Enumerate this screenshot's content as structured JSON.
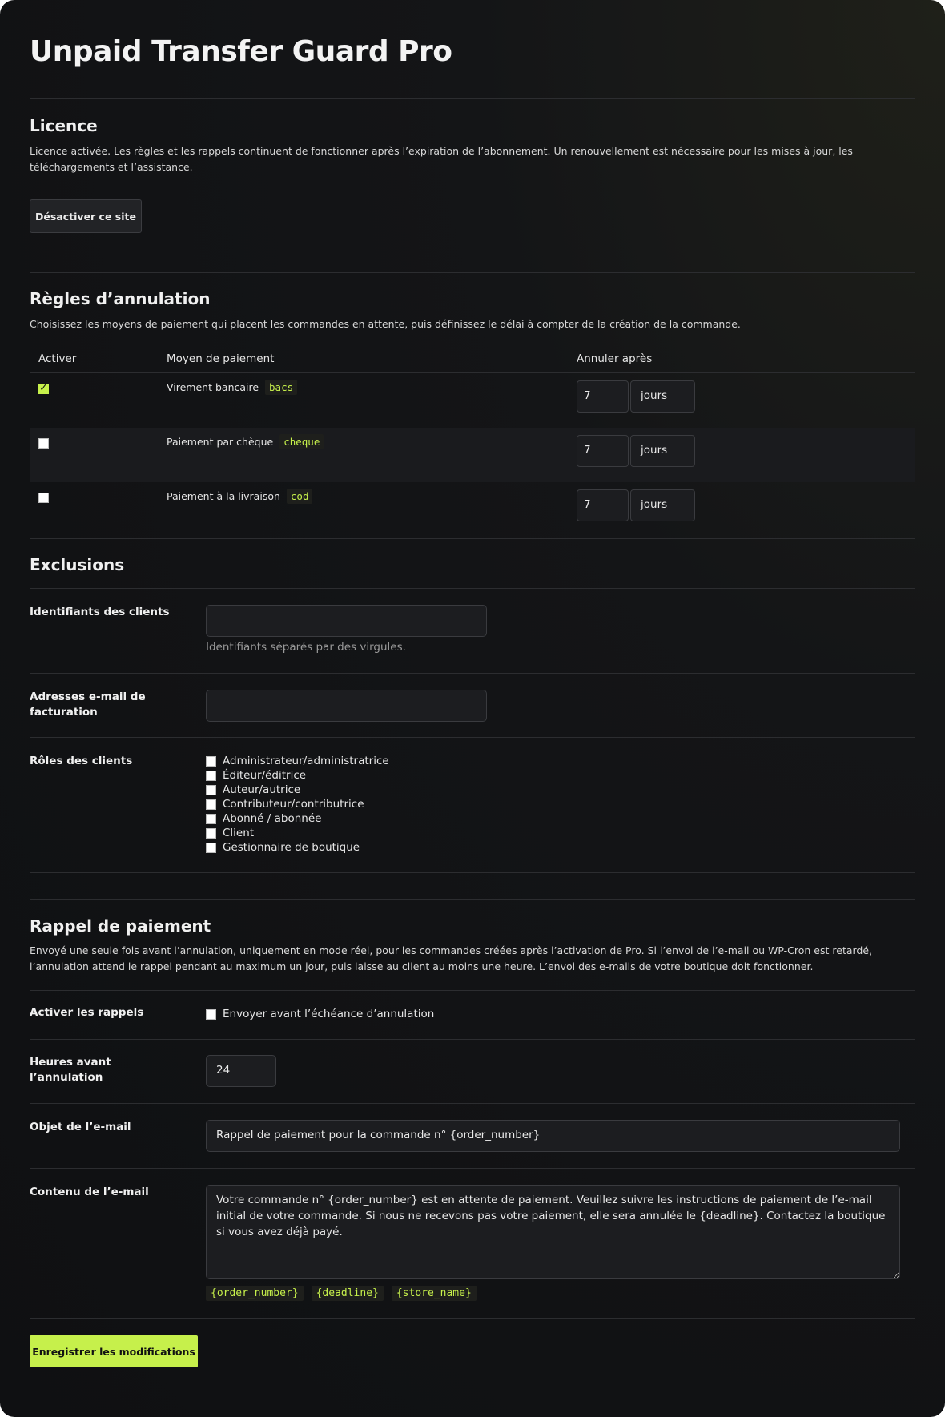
{
  "page": {
    "title": "Unpaid Transfer Guard Pro"
  },
  "license": {
    "heading": "Licence",
    "description": "Licence activée. Les règles et les rappels continuent de fonctionner après l’expiration de l’abonnement. Un renouvellement est nécessaire pour les mises à jour, les téléchargements et l’assistance.",
    "deactivate_label": "Désactiver ce site"
  },
  "rules": {
    "heading": "Règles d’annulation",
    "description": "Choisissez les moyens de paiement qui placent les commandes en attente, puis définissez le délai à compter de la création de la commande.",
    "columns": {
      "enable": "Activer",
      "method": "Moyen de paiement",
      "cancel_after": "Annuler après"
    },
    "rows": [
      {
        "enabled": true,
        "label": "Virement bancaire",
        "code": "bacs",
        "value": "7",
        "unit": "jours"
      },
      {
        "enabled": false,
        "label": "Paiement par chèque",
        "code": "cheque",
        "value": "7",
        "unit": "jours"
      },
      {
        "enabled": false,
        "label": "Paiement à la livraison",
        "code": "cod",
        "value": "7",
        "unit": "jours"
      }
    ]
  },
  "exclusions": {
    "heading": "Exclusions",
    "customer_ids_label": "Identifiants des clients",
    "customer_ids_value": "",
    "customer_ids_hint": "Identifiants séparés par des virgules.",
    "billing_emails_label": "Adresses e-mail de facturation",
    "billing_emails_value": "",
    "roles_label": "Rôles des clients",
    "roles": [
      "Administrateur/administratrice",
      "Éditeur/éditrice",
      "Auteur/autrice",
      "Contributeur/contributrice",
      "Abonné / abonnée",
      "Client",
      "Gestionnaire de boutique"
    ]
  },
  "reminder": {
    "heading": "Rappel de paiement",
    "description": "Envoyé une seule fois avant l’annulation, uniquement en mode réel, pour les commandes créées après l’activation de Pro. Si l’envoi de l’e-mail ou WP-Cron est retardé, l’annulation attend le rappel pendant au maximum un jour, puis laisse au client au moins une heure. L’envoi des e-mails de votre boutique doit fonctionner.",
    "enable_label": "Activer les rappels",
    "enable_checkbox_label": "Envoyer avant l’échéance d’annulation",
    "enabled": false,
    "hours_label": "Heures avant l’annulation",
    "hours_value": "24",
    "subject_label": "Objet de l’e-mail",
    "subject_value": "Rappel de paiement pour la commande n° {order_number}",
    "content_label": "Contenu de l’e-mail",
    "content_value": "Votre commande n° {order_number} est en attente de paiement. Veuillez suivre les instructions de paiement de l’e-mail initial de votre commande. Si nous ne recevons pas votre paiement, elle sera annulée le {deadline}. Contactez la boutique si vous avez déjà payé.",
    "tokens": [
      "{order_number}",
      "{deadline}",
      "{store_name}"
    ]
  },
  "footer": {
    "save_label": "Enregistrer les modifications"
  },
  "colors": {
    "accent": "#c6f04b",
    "background": "#121315"
  }
}
